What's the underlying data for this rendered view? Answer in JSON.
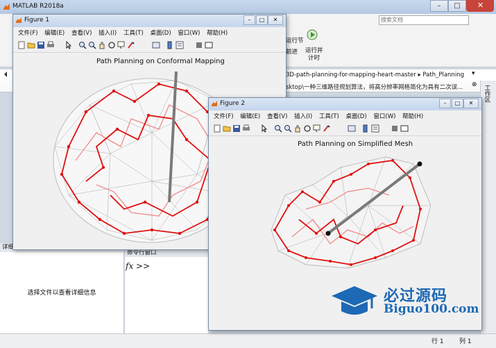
{
  "app": {
    "title": "MATLAB R2018a",
    "search_placeholder": "搜索文档"
  },
  "toolstrip": {
    "run_section_label": "运行节",
    "advance_label": "前进",
    "run_time_label_1": "运行并",
    "run_time_label_2": "计时"
  },
  "path": {
    "current": "3D-path-planning-for-mapping-heart-master ▸ Path_Planning",
    "warning": "sktop\\一种三维路径规划算法，将高分辨率网格简化为具有二次误..."
  },
  "right_panel": {
    "label": "工作区"
  },
  "details": {
    "header": "详细信息",
    "message": "选择文件以查看详细信息"
  },
  "command_window": {
    "header": "命令行窗口",
    "prompt": "fx >>"
  },
  "status": {
    "row": "行  1",
    "col": "列  1"
  },
  "menu_items": [
    "文件(F)",
    "编辑(E)",
    "查看(V)",
    "插入(I)",
    "工具(T)",
    "桌面(D)",
    "窗口(W)",
    "帮助(H)"
  ],
  "figure1": {
    "title": "Figure 1",
    "plot_title": "Path Planning on Conformal Mapping"
  },
  "figure2": {
    "title": "Figure 2",
    "plot_title": "Path Planning on Simplified Mesh"
  },
  "watermark": {
    "line1": "必过源码",
    "line2": "Biguo100.com"
  },
  "colors": {
    "path": "#e01010",
    "path_light": "#f08a8a",
    "mesh": "#9a9a9a",
    "route": "#707070",
    "accent": "#1d69b5"
  }
}
